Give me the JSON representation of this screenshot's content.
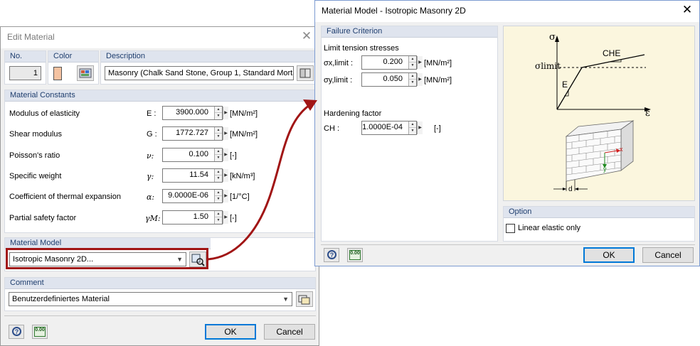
{
  "edit_material": {
    "title": "Edit Material",
    "no_header": "No.",
    "no_value": "1",
    "color_header": "Color",
    "swatch_color": "#f4c2a1",
    "description_header": "Description",
    "description_value": "Masonry (Chalk Sand Stone, Group 1, Standard Mortar",
    "constants_header": "Material Constants",
    "constants": [
      {
        "label": "Modulus of elasticity",
        "symbol": "E :",
        "value": "3900.000",
        "unit": "[MN/m²]"
      },
      {
        "label": "Shear modulus",
        "symbol": "G :",
        "value": "1772.727",
        "unit": "[MN/m²]"
      },
      {
        "label": "Poisson's ratio",
        "symbol": "ν:",
        "value": "0.100",
        "unit": "[-]"
      },
      {
        "label": "Specific weight",
        "symbol": "γ:",
        "value": "11.54",
        "unit": "[kN/m³]"
      },
      {
        "label": "Coefficient of thermal expansion",
        "symbol": "α:",
        "value": "9.0000E-06",
        "unit": "[1/°C]"
      },
      {
        "label": "Partial safety factor",
        "symbol": "γM:",
        "value": "1.50",
        "unit": "[-]"
      }
    ],
    "model_header": "Material Model",
    "model_value": "Isotropic Masonry 2D...",
    "comment_header": "Comment",
    "comment_value": "Benutzerdefiniertes Material",
    "calc_text": "0.00",
    "ok_label": "OK",
    "cancel_label": "Cancel"
  },
  "material_model": {
    "title": "Material Model - Isotropic Masonry 2D",
    "failure_header": "Failure Criterion",
    "limit_label": "Limit tension stresses",
    "sx_symbol": "σx,limit :",
    "sx_value": "0.200",
    "sx_unit": "[MN/m²]",
    "sy_symbol": "σy,limit :",
    "sy_value": "0.050",
    "sy_unit": "[MN/m²]",
    "hardening_label": "Hardening factor",
    "ch_symbol": "CH :",
    "ch_value": "1.0000E-04",
    "ch_unit": "[-]",
    "diagram": {
      "sigma": "σ",
      "sigma_limit": "σlimit",
      "che": "CHE",
      "e": "E",
      "epsilon": "ε",
      "x_axis": "x",
      "y_axis": "y",
      "d": "d"
    },
    "option_header": "Option",
    "linear_elastic_label": "Linear elastic only",
    "linear_elastic_checked": false,
    "calc_text": "0.00",
    "ok_label": "OK",
    "cancel_label": "Cancel"
  }
}
